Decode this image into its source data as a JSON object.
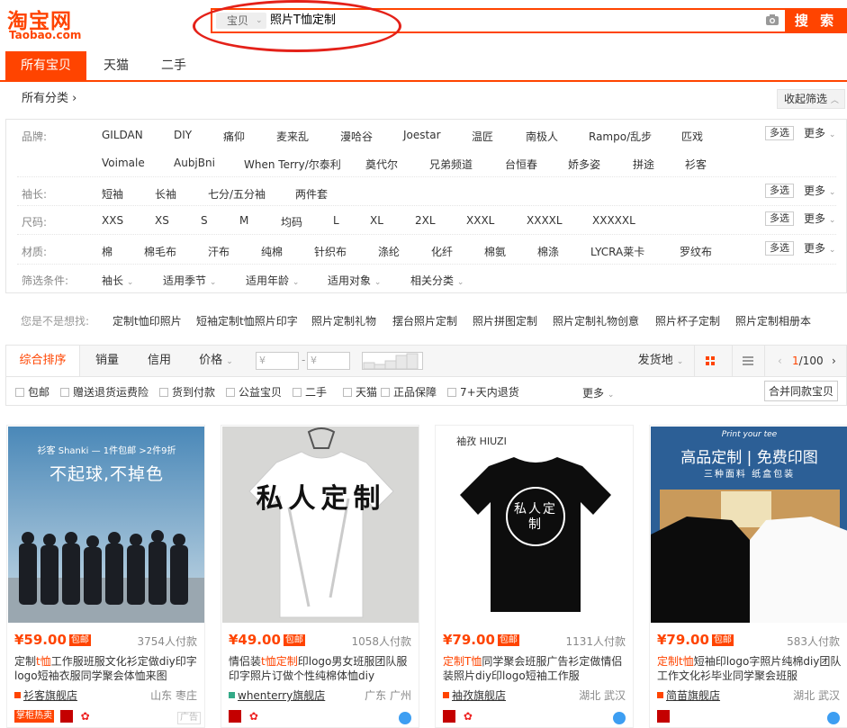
{
  "logo": {
    "cn": "淘宝网",
    "en": "Taobao.com"
  },
  "search": {
    "scope": "宝贝",
    "query": "照片T恤定制",
    "button": "搜 索"
  },
  "tabs": [
    "所有宝贝",
    "天猫",
    "二手"
  ],
  "category_bar": {
    "label": "所有分类",
    "collapse": "收起筛选"
  },
  "filters": {
    "brand": {
      "label": "品牌:",
      "row1": [
        "GILDAN",
        "DIY",
        "痛仰",
        "麦来乱",
        "漫哈谷",
        "Joestar",
        "温匠",
        "南极人",
        "Rampo/乱步",
        "匹戏"
      ],
      "row2": [
        "Voimale",
        "AubjBni",
        "When Terry/尔泰利",
        "奠代尔",
        "兄弟频道",
        "台恒春",
        "娇多姿",
        "拼途",
        "衫客"
      ]
    },
    "sleeve": {
      "label": "袖长:",
      "items": [
        "短袖",
        "长袖",
        "七分/五分袖",
        "两件套"
      ]
    },
    "size": {
      "label": "尺码:",
      "items": [
        "XXS",
        "XS",
        "S",
        "M",
        "均码",
        "L",
        "XL",
        "2XL",
        "XXXL",
        "XXXXL",
        "XXXXXL"
      ]
    },
    "material": {
      "label": "材质:",
      "items": [
        "棉",
        "棉毛布",
        "汗布",
        "纯棉",
        "针织布",
        "涤纶",
        "化纤",
        "棉氨",
        "棉涤",
        "LYCRA莱卡",
        "罗纹布"
      ]
    },
    "conditions": {
      "label": "筛选条件:",
      "items": [
        "袖长",
        "适用季节",
        "适用年龄",
        "适用对象",
        "相关分类"
      ]
    },
    "multi": "多选",
    "more": "更多"
  },
  "guess": {
    "label": "您是不是想找:",
    "items": [
      "定制t恤印照片",
      "短袖定制t恤照片印字",
      "照片定制礼物",
      "摆台照片定制",
      "照片拼图定制",
      "照片定制礼物创意",
      "照片杯子定制",
      "照片定制相册本"
    ]
  },
  "sort": {
    "items": [
      "综合排序",
      "销量",
      "信用",
      "价格"
    ],
    "price_placeholder": "¥",
    "location": "发货地",
    "page": "1/100"
  },
  "options": {
    "items": [
      "包邮",
      "赠送退货运费险",
      "货到付款",
      "公益宝贝",
      "二手",
      "天猫",
      "正品保障",
      "7+天内退货"
    ],
    "more": "更多",
    "merge": "合并同款宝贝"
  },
  "products": [
    {
      "price": "¥59.00",
      "badge": "包邮",
      "sales": "3754人付款",
      "title_pre": "定制",
      "title_hl": "t恤",
      "title_post": "工作服班服文化衫定做diy印字logo短袖衣服同学聚会体恤来图",
      "shop": "衫客旗舰店",
      "location": "山东 枣庄",
      "tag": "掌柜热卖",
      "ad": "广告",
      "img_text": "不起球,不掉色",
      "img_sub": "衫客 Shanki — 1件包邮 >2件9折"
    },
    {
      "price": "¥49.00",
      "badge": "包邮",
      "sales": "1058人付款",
      "title_pre": "情侣装",
      "title_hl": "t恤定制",
      "title_post": "印logo男女班服团队服印字照片订做个性纯棉体恤diy",
      "shop": "whenterry旗舰店",
      "location": "广东 广州",
      "img_text": "私人定制"
    },
    {
      "price": "¥79.00",
      "badge": "包邮",
      "sales": "1131人付款",
      "title_pre": "",
      "title_hl": "定制T恤",
      "title_post": "同学聚会班服广告衫定做情侣装照片diy印logo短袖工作服",
      "shop": "袖孜旗舰店",
      "location": "湖北 武汉",
      "img_text": "私人定制",
      "img_brand": "袖孜 HIUZI"
    },
    {
      "price": "¥79.00",
      "badge": "包邮",
      "sales": "583人付款",
      "title_pre": "",
      "title_hl": "定制t恤",
      "title_post": "短袖印logo字照片纯棉diy团队工作文化衫毕业同学聚会班服",
      "shop": "简苗旗舰店",
      "location": "湖北 武汉",
      "img_text": "高品定制 | 免费印图",
      "img_sub": "三种面料  纸盒包装",
      "img_top": "Print your tee"
    }
  ],
  "colors": {
    "accent": "#ff4400",
    "highlight": "#e42119"
  }
}
